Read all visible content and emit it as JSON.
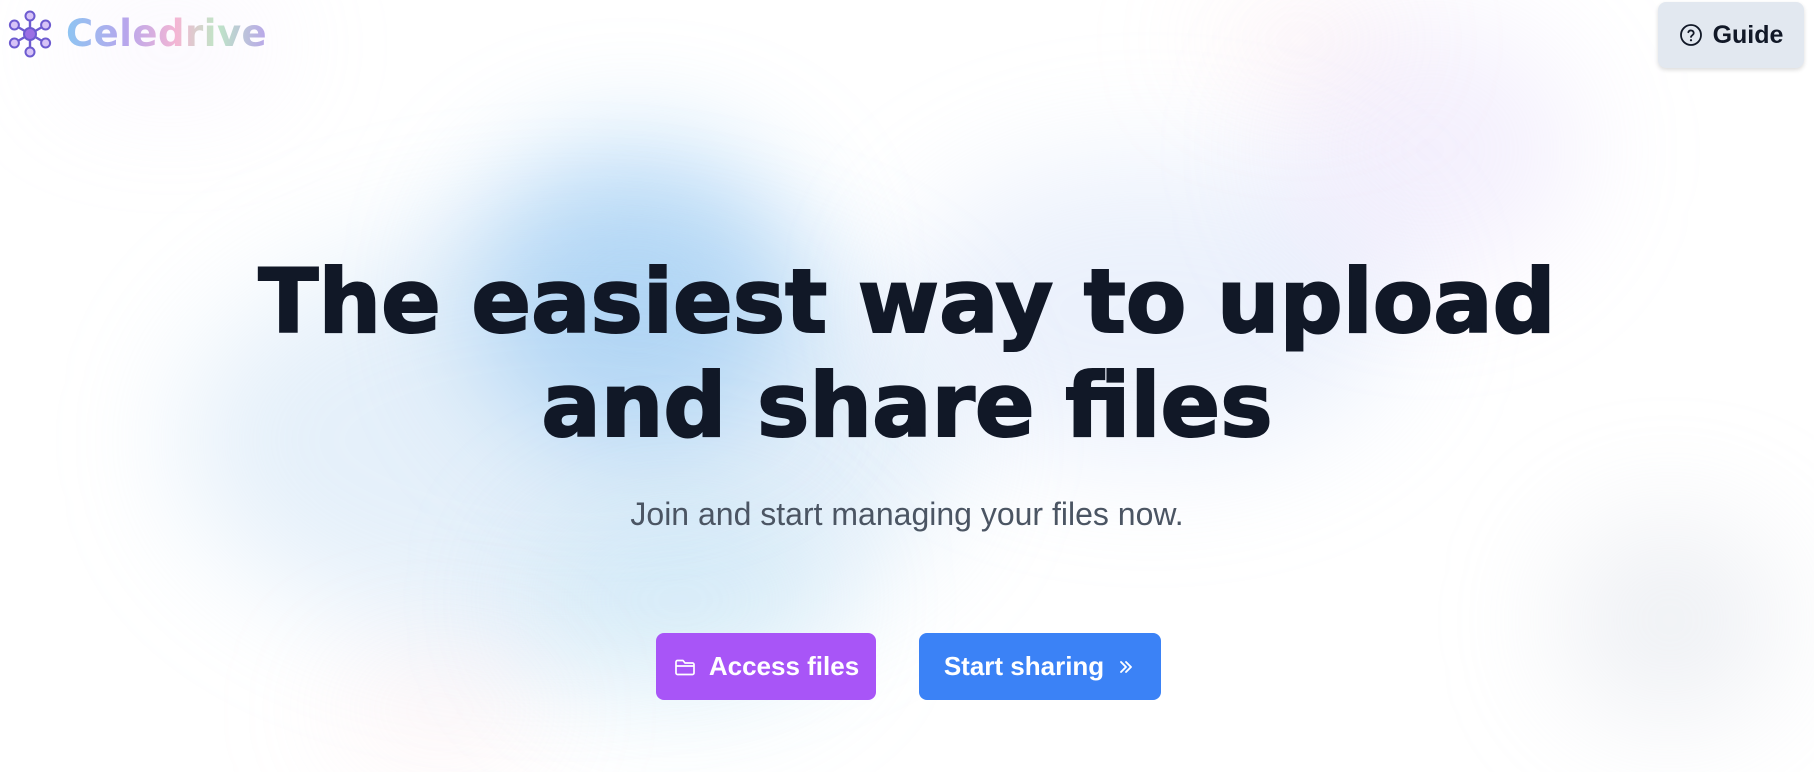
{
  "header": {
    "logo_text": "Celedrive",
    "logo_icon": "network-nodes-icon",
    "guide_button": {
      "label": "Guide",
      "icon": "question-circle-icon"
    }
  },
  "hero": {
    "title_line1": "The easiest way to upload",
    "title_line2": "and share files",
    "subtitle": "Join and start managing your files now."
  },
  "actions": {
    "access_files": {
      "label": "Access files",
      "icon": "folder-icon",
      "color": "#a855f7"
    },
    "start_sharing": {
      "label": "Start sharing",
      "icon": "chevrons-right-icon",
      "color": "#3b82f6"
    }
  },
  "colors": {
    "title_text": "#111827",
    "subtitle_text": "#4b5563",
    "guide_button_bg": "#e2e8f0"
  }
}
